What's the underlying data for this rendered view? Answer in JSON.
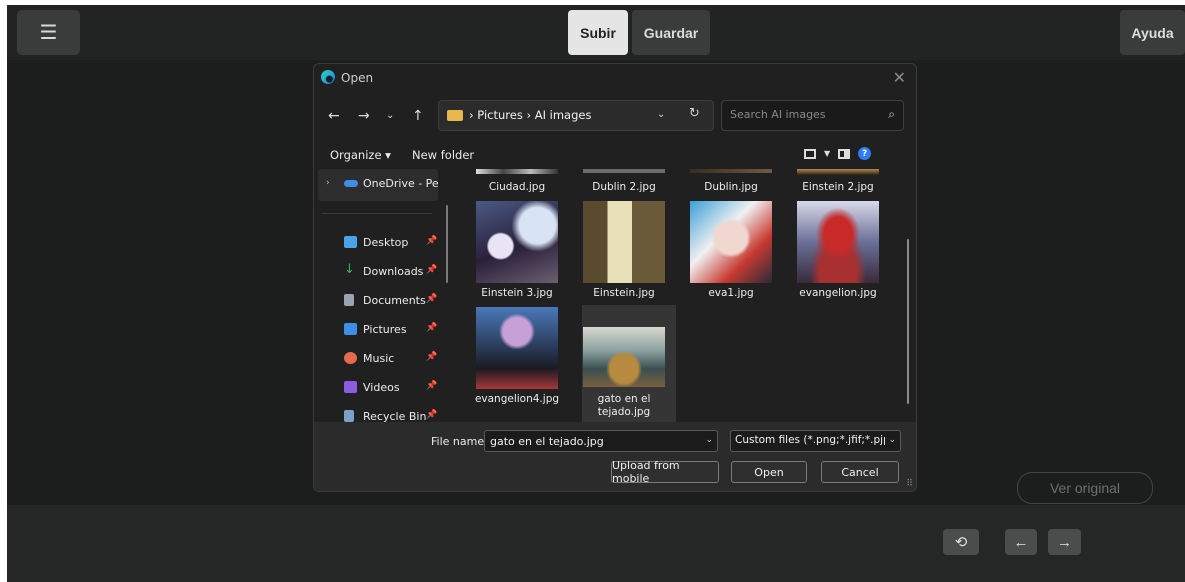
{
  "toolbar": {
    "menu_icon": "hamburger-menu-icon",
    "upload_label": "Subir",
    "save_label": "Guardar",
    "help_label": "Ayuda"
  },
  "view_original_label": "Ver original",
  "bottom_controls": {
    "undo_icon": "undo-icon",
    "prev_icon": "arrow-left-icon",
    "next_icon": "arrow-right-icon"
  },
  "dialog": {
    "title": "Open",
    "close_icon": "close-icon",
    "path": [
      "Pictures",
      "AI images"
    ],
    "search_placeholder": "Search AI images",
    "organize_label": "Organize ▾",
    "new_folder_label": "New folder",
    "nav_pane": {
      "onedrive_label": "OneDrive - Pers",
      "items": [
        {
          "label": "Desktop",
          "icon": "desktop-icon",
          "color": "#4aa3e8"
        },
        {
          "label": "Downloads",
          "icon": "downloads-icon",
          "color": "#39b36b"
        },
        {
          "label": "Documents",
          "icon": "documents-icon",
          "color": "#9aa4b2"
        },
        {
          "label": "Pictures",
          "icon": "pictures-icon",
          "color": "#3d8ee6"
        },
        {
          "label": "Music",
          "icon": "music-icon",
          "color": "#e76a4b"
        },
        {
          "label": "Videos",
          "icon": "videos-icon",
          "color": "#8a5de0"
        },
        {
          "label": "Recycle Bin",
          "icon": "recycle-bin-icon",
          "color": "#7ca0c8"
        }
      ]
    },
    "files_partial": [
      "Ciudad.jpg",
      "Dublin 2.jpg",
      "Dublin.jpg",
      "Einstein 2.jpg"
    ],
    "files": [
      {
        "name": "Einstein 3.jpg"
      },
      {
        "name": "Einstein.jpg"
      },
      {
        "name": "eva1.jpg"
      },
      {
        "name": "evangelion.jpg"
      },
      {
        "name": "evangelion4.jpg"
      },
      {
        "name_line1": "gato en el",
        "name_line2": "tejado.jpg"
      }
    ],
    "file_name_label": "File name:",
    "file_name_value": "gato en el tejado.jpg",
    "file_type_value": "Custom files (*.png;*.jfif;*.pjp;*",
    "upload_mobile_label": "Upload from mobile",
    "open_label": "Open",
    "cancel_label": "Cancel"
  }
}
